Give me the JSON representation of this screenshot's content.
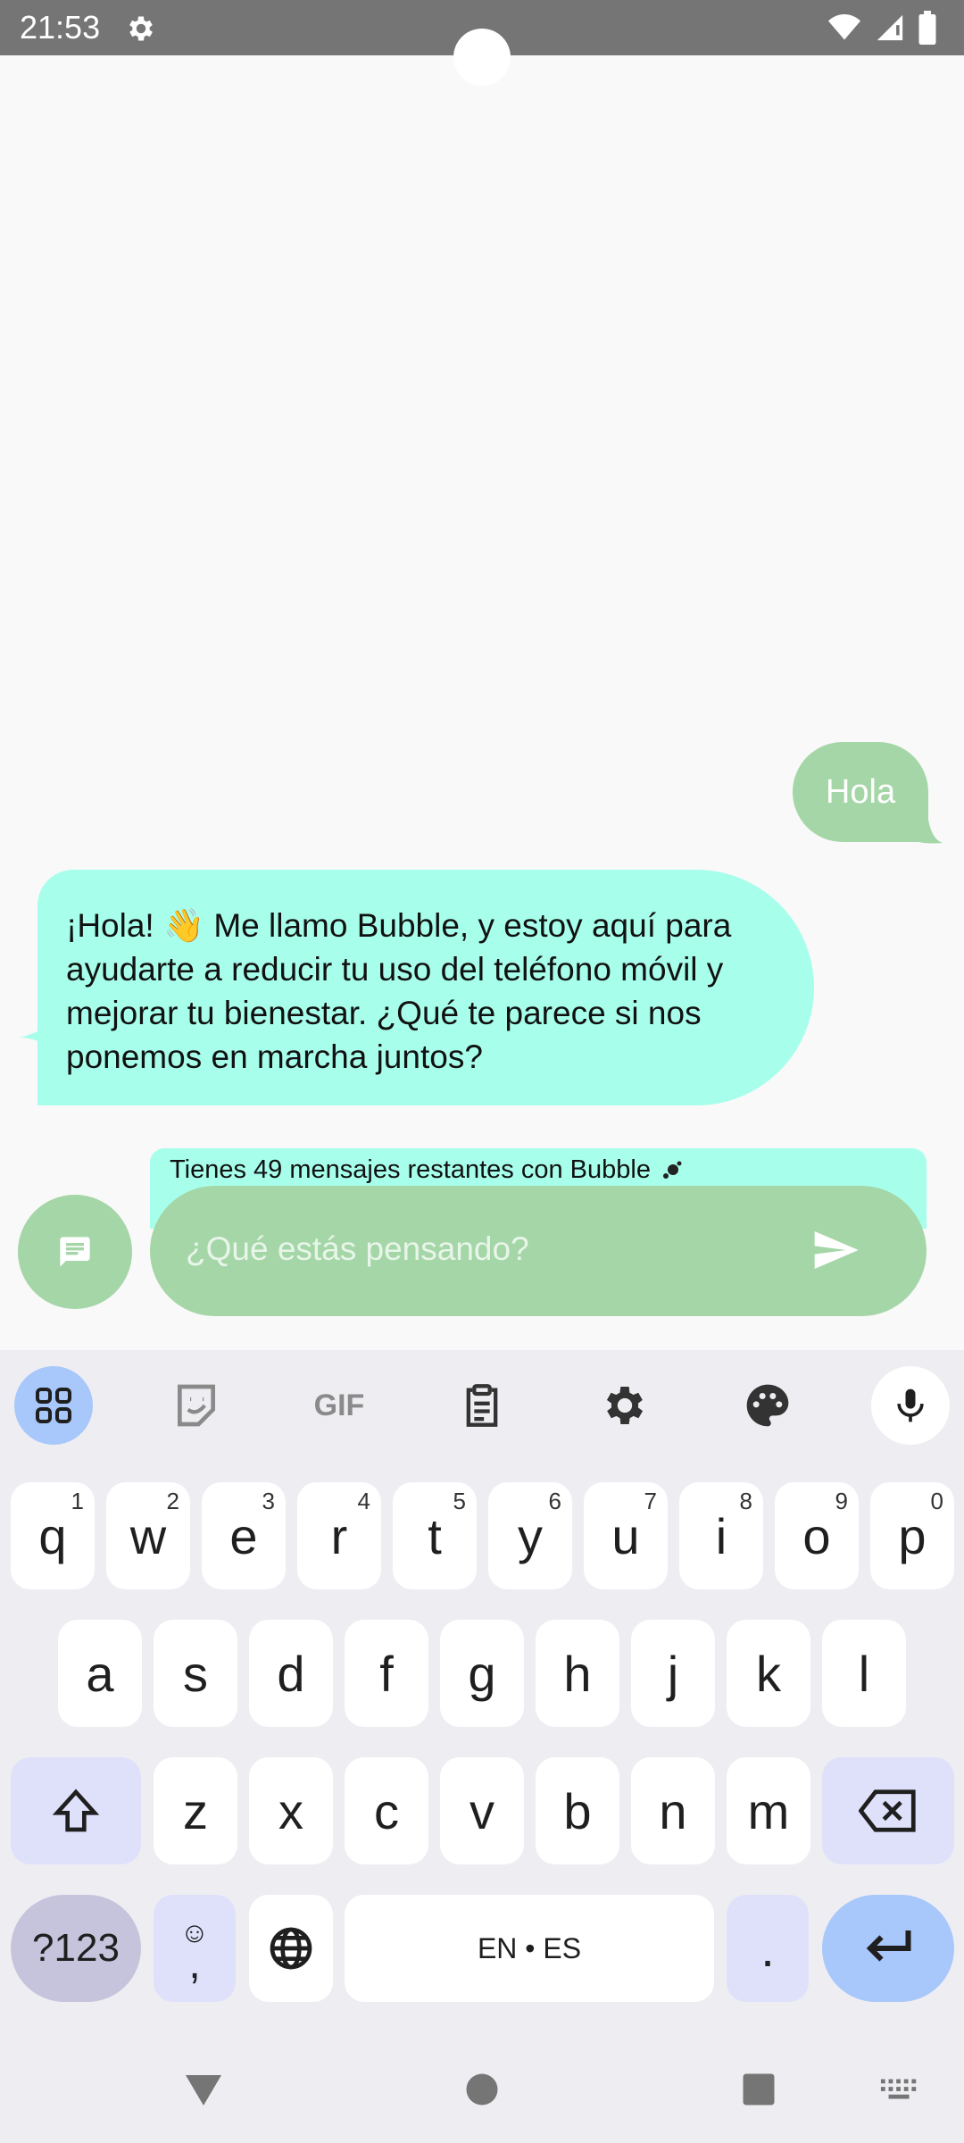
{
  "status_bar": {
    "time": "21:53"
  },
  "chat": {
    "user_message": "Hola",
    "bot_message": "¡Hola! 👋 Me llamo Bubble, y estoy aquí para ayudarte a reducir tu uso del teléfono móvil y mejorar tu bienestar. ¿Qué te parece si nos ponemos en marcha juntos?"
  },
  "banner": {
    "remaining_text": "Tienes 49 mensajes restantes con Bubble"
  },
  "input": {
    "placeholder": "¿Qué estás pensando?",
    "value": ""
  },
  "keyboard": {
    "toolbar": [
      "apps-grid-icon",
      "sticker-icon",
      "gif-icon",
      "clipboard-icon",
      "gear-icon",
      "palette-icon",
      "mic-icon"
    ],
    "gif_label": "GIF",
    "row1": [
      {
        "k": "q",
        "h": "1"
      },
      {
        "k": "w",
        "h": "2"
      },
      {
        "k": "e",
        "h": "3"
      },
      {
        "k": "r",
        "h": "4"
      },
      {
        "k": "t",
        "h": "5"
      },
      {
        "k": "y",
        "h": "6"
      },
      {
        "k": "u",
        "h": "7"
      },
      {
        "k": "i",
        "h": "8"
      },
      {
        "k": "o",
        "h": "9"
      },
      {
        "k": "p",
        "h": "0"
      }
    ],
    "row2": [
      "a",
      "s",
      "d",
      "f",
      "g",
      "h",
      "j",
      "k",
      "l"
    ],
    "row3": [
      "z",
      "x",
      "c",
      "v",
      "b",
      "n",
      "m"
    ],
    "symbols_label": "?123",
    "comma_label": ",",
    "emoji_hint": "☺",
    "space_label": "EN • ES",
    "period_label": "."
  },
  "colors": {
    "accent_green": "#a5d6a7",
    "bot_bubble": "#a7ffeb",
    "keyboard_bg": "#eeeef2",
    "key_blue": "#a8c7fa"
  }
}
